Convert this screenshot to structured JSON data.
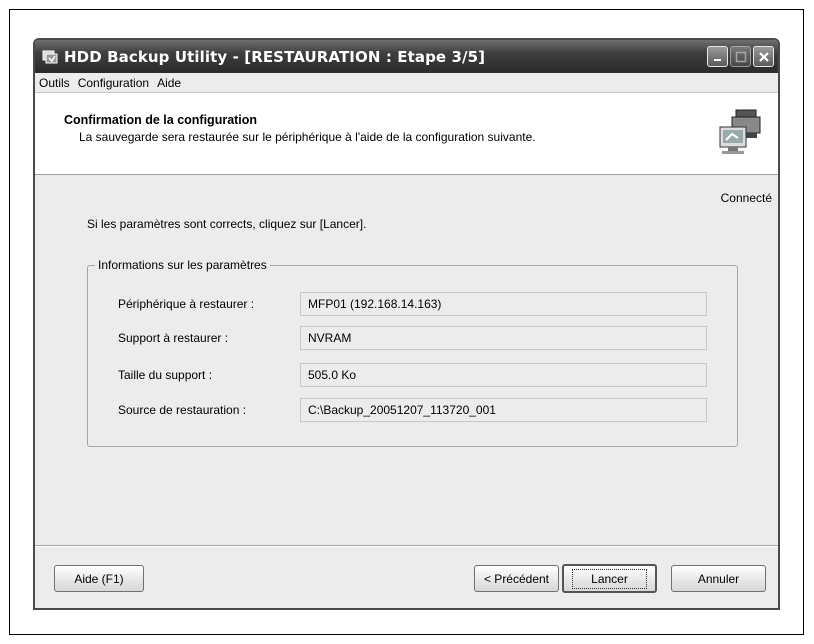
{
  "window": {
    "title": "HDD Backup Utility - [RESTAURATION : Etape 3/5]"
  },
  "menu": {
    "items": [
      "Outils",
      "Configuration",
      "Aide"
    ]
  },
  "header": {
    "title": "Confirmation de la configuration",
    "subtitle": "La sauvegarde sera restaurée sur le périphérique à l'aide de la configuration suivante."
  },
  "status": "Connecté",
  "instruction": "Si les paramètres sont corrects, cliquez sur [Lancer].",
  "group": {
    "label": "Informations sur les paramètres",
    "rows": [
      {
        "label": "Périphérique à restaurer :",
        "value": "MFP01 (192.168.14.163)"
      },
      {
        "label": "Support à restaurer :",
        "value": "NVRAM"
      },
      {
        "label": "Taille du support :",
        "value": "505.0 Ko"
      },
      {
        "label": "Source de restauration :",
        "value": "C:\\Backup_20051207_113720_001"
      }
    ]
  },
  "buttons": {
    "help": "Aide (F1)",
    "previous": "< Précédent",
    "start": "Lancer",
    "cancel": "Annuler"
  },
  "icons": {
    "app": "backup-app-icon",
    "header": "printer-computer-icon",
    "minimize": "minimize-icon",
    "maximize": "maximize-icon",
    "close": "close-icon"
  }
}
